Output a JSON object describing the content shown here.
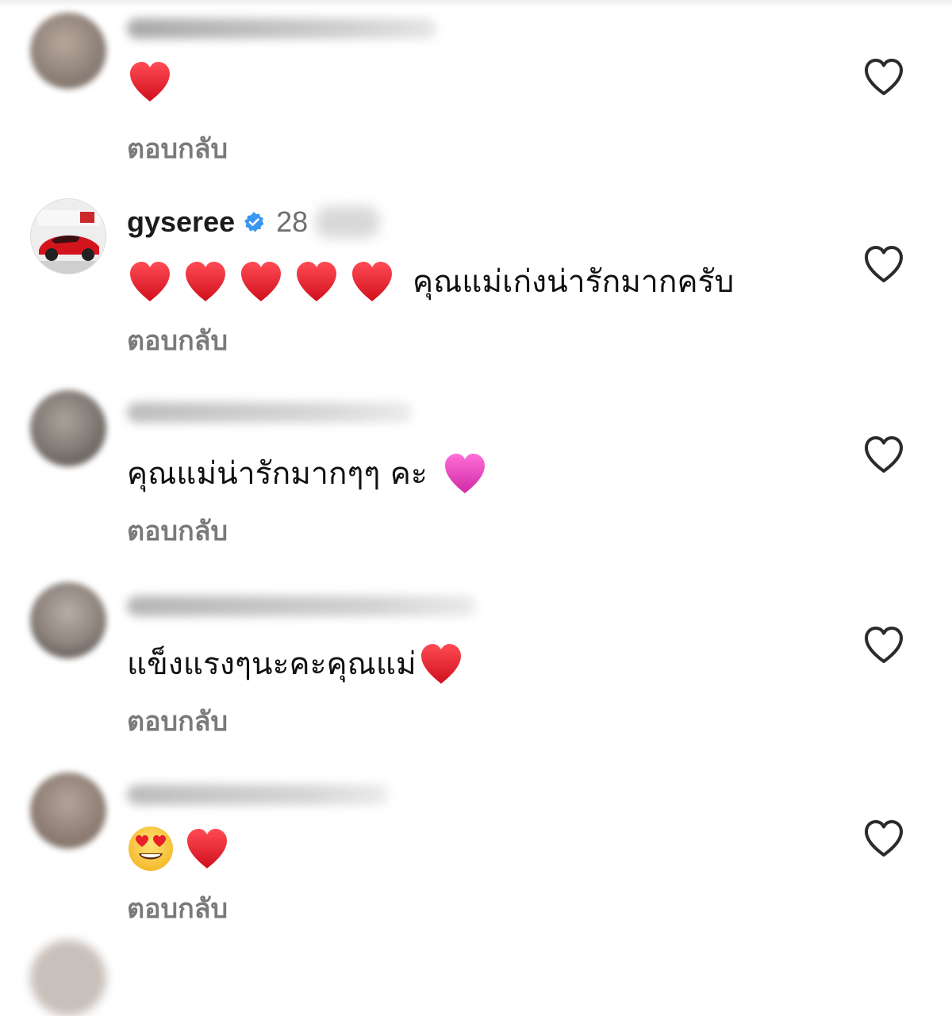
{
  "reply_label": "ตอบกลับ",
  "icons": {
    "like": "heart-outline-icon",
    "verified": "verified-badge-icon",
    "red_heart": "red-heart-emoji",
    "pink_heart": "pink-heart-emoji",
    "heart_eyes": "heart-eyes-emoji"
  },
  "colors": {
    "verified": "#3897f0",
    "red_heart": "#e8202a",
    "pink_heart": "#e23fb6",
    "reply": "#7a7a7a"
  },
  "comments": [
    {
      "username": "",
      "time": "",
      "text": "",
      "emojis_before": 1
    },
    {
      "username": "gyseree",
      "time": "28",
      "verified": true,
      "text": "คุณแม่เก่งน่ารักมากครับ",
      "emojis_before": 5
    },
    {
      "username": "",
      "time": "",
      "text": "คุณแม่น่ารักมากๆๆ คะ"
    },
    {
      "username": "",
      "time": "",
      "text": "แข็งแรงๆนะคะคุณแม่"
    },
    {
      "username": "",
      "time": "",
      "text": ""
    }
  ]
}
